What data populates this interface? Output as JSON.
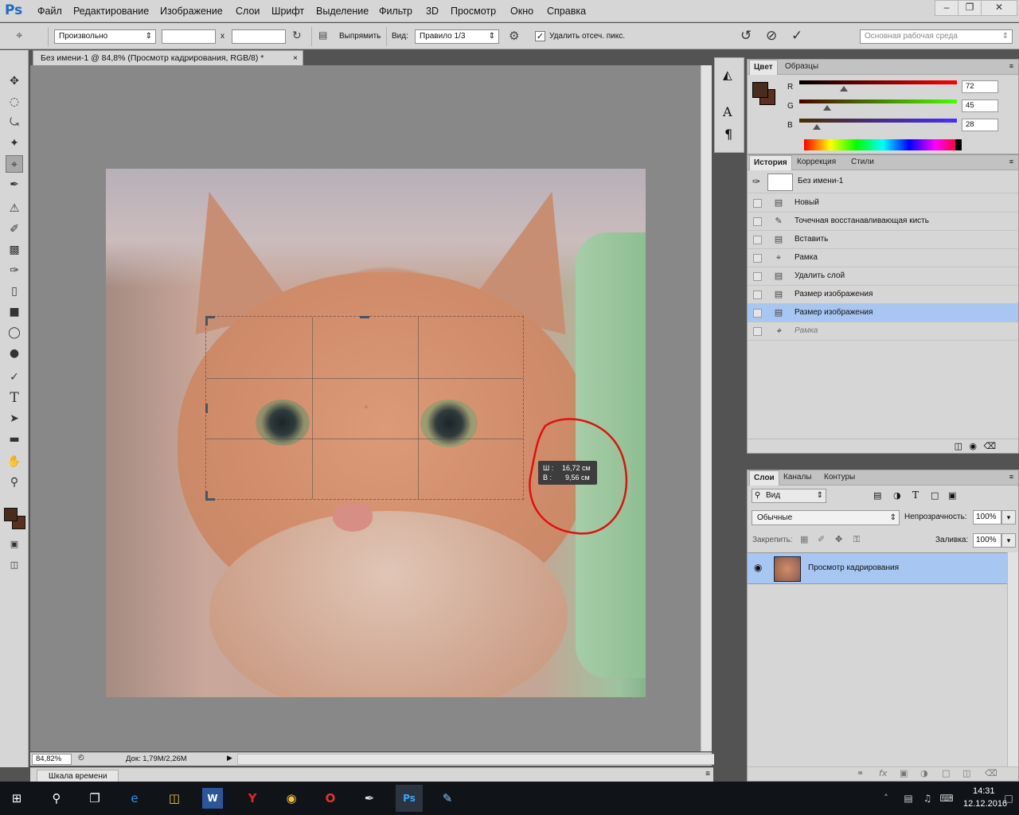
{
  "app": {
    "logo": "Ps"
  },
  "menu": [
    "Файл",
    "Редактирование",
    "Изображение",
    "Слои",
    "Шрифт",
    "Выделение",
    "Фильтр",
    "3D",
    "Просмотр",
    "Окно",
    "Справка"
  ],
  "options": {
    "ratio_select": "Произвольно",
    "width_value": "",
    "height_value": "",
    "times_symbol": "x",
    "straighten_label": "Выпрямить",
    "view_label": "Вид:",
    "view_select": "Правило 1/3",
    "delete_cropped_label": "Удалить отсеч. пикс.",
    "delete_cropped_checked": true,
    "workspace_select": "Основная рабочая среда"
  },
  "document": {
    "tab_title": "Без имени-1 @ 84,8% (Просмотр кадрирования, RGB/8) *",
    "zoom": "84,82%",
    "doc_info": "Док: 1,79M/2,26M",
    "crop_tip_w_label": "Ш :",
    "crop_tip_w_value": "16,72 см",
    "crop_tip_h_label": "В :",
    "crop_tip_h_value": "9,56 см"
  },
  "timeline": {
    "label": "Шкала времени"
  },
  "color_panel": {
    "tabs": [
      "Цвет",
      "Образцы"
    ],
    "r_label": "R",
    "r_value": "72",
    "g_label": "G",
    "g_value": "45",
    "b_label": "B",
    "b_value": "28",
    "foreground": "#482d1c"
  },
  "history_panel": {
    "tabs": [
      "История",
      "Коррекция",
      "Стили"
    ],
    "snapshot": "Без имени-1",
    "items": [
      "Новый",
      "Точечная восстанавливающая кисть",
      "Вставить",
      "Рамка",
      "Удалить слой",
      "Размер изображения",
      "Размер изображения",
      "Рамка"
    ]
  },
  "layers_panel": {
    "tabs": [
      "Слои",
      "Каналы",
      "Контуры"
    ],
    "filter_label": "Вид",
    "blend_mode": "Обычные",
    "opacity_label": "Непрозрачность:",
    "opacity_value": "100%",
    "lock_label": "Закрепить:",
    "fill_label": "Заливка:",
    "fill_value": "100%",
    "layer_name": "Просмотр кадрирования"
  },
  "taskbar": {
    "time": "14:31",
    "date": "12.12.2016"
  }
}
